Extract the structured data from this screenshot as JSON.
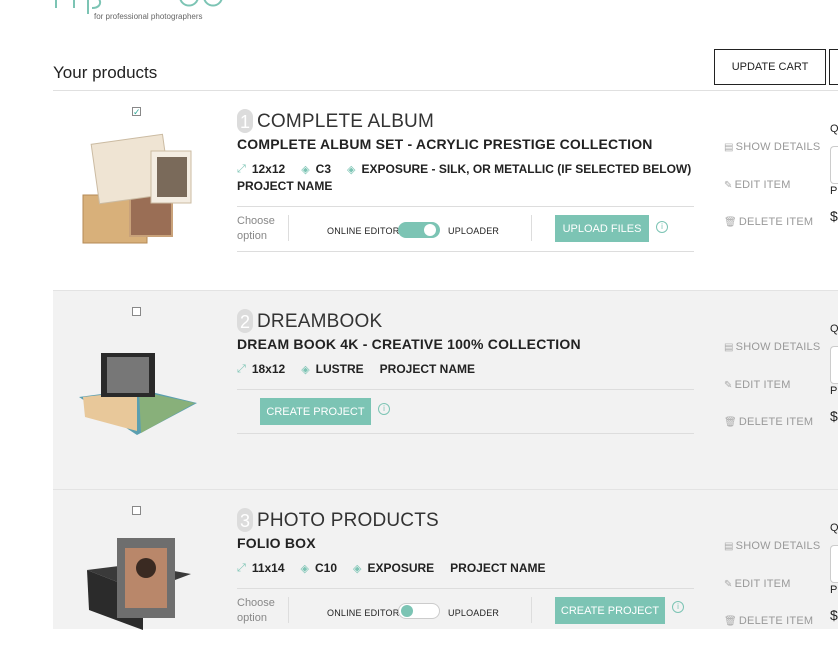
{
  "header": {
    "logo_tagline": "for professional photographers",
    "page_title": "Your products",
    "update_cart_label": "UPDATE CART"
  },
  "colors": {
    "accent": "#7cc4b4",
    "row_alt": "#f2f2f2"
  },
  "items": [
    {
      "number": "1",
      "category": "COMPLETE ALBUM",
      "product": "COMPLETE ALBUM SET - ACRYLIC PRESTIGE COLLECTION",
      "specs": [
        "12x12",
        "C3",
        "EXPOSURE - SILK, OR METALLIC (IF SELECTED BELOW)"
      ],
      "project_name": "PROJECT NAME",
      "checked": true,
      "choose_option": "Choose option",
      "editor_label": "ONLINE EDITOR",
      "uploader_label": "UPLOADER",
      "toggle": "on",
      "button_label": "UPLOAD FILES",
      "actions": [
        "SHOW DETAILS",
        "EDIT ITEM",
        "DELETE ITEM"
      ],
      "qty_label": "Q",
      "price_label": "P",
      "currency": "$"
    },
    {
      "number": "2",
      "category": "DREAMBOOK",
      "product": "DREAM BOOK 4K - CREATIVE 100% COLLECTION",
      "specs": [
        "18x12",
        "LUSTRE"
      ],
      "project_name": "PROJECT NAME",
      "checked": false,
      "button_label": "CREATE PROJECT",
      "actions": [
        "SHOW DETAILS",
        "EDIT ITEM",
        "DELETE ITEM"
      ],
      "qty_label": "Q",
      "price_label": "P",
      "currency": "$"
    },
    {
      "number": "3",
      "category": "PHOTO PRODUCTS",
      "product": "FOLIO BOX",
      "specs": [
        "11x14",
        "C10",
        "EXPOSURE"
      ],
      "project_name": "PROJECT NAME",
      "checked": false,
      "choose_option": "Choose option",
      "editor_label": "ONLINE EDITOR",
      "uploader_label": "UPLOADER",
      "toggle": "off",
      "button_label": "CREATE PROJECT",
      "actions": [
        "SHOW DETAILS",
        "EDIT ITEM",
        "DELETE ITEM"
      ],
      "qty_label": "Q",
      "price_label": "P",
      "currency": "$"
    }
  ]
}
